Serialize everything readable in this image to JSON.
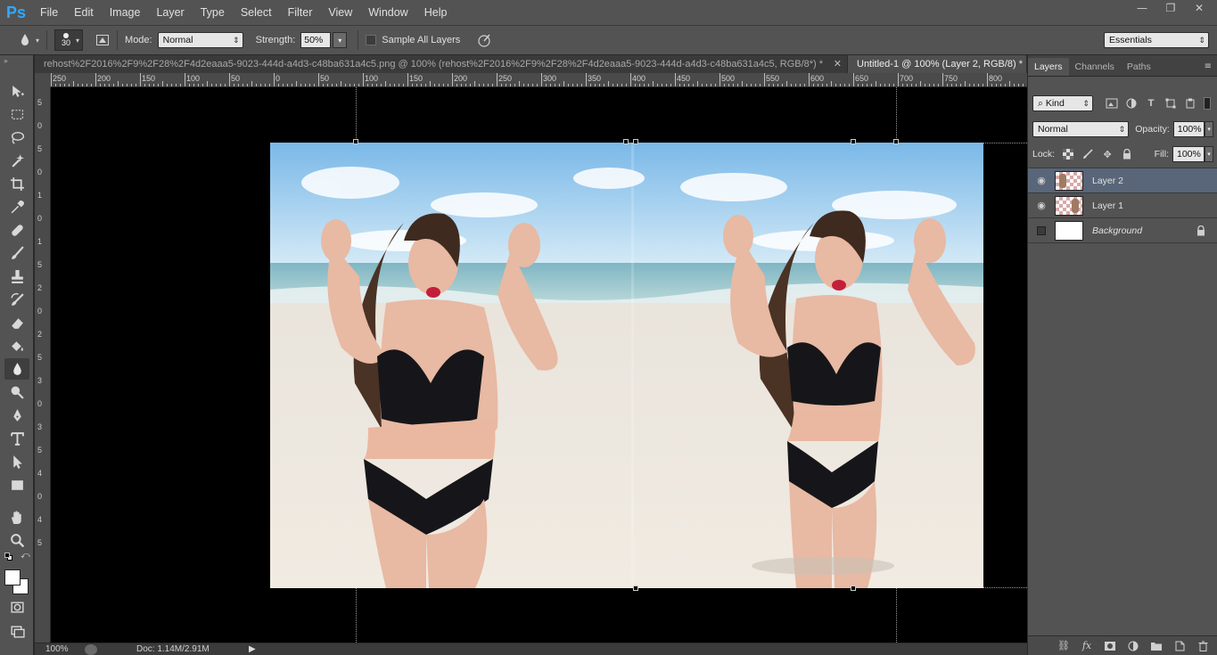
{
  "app": {
    "logo": "Ps"
  },
  "menu": [
    "File",
    "Edit",
    "Image",
    "Layer",
    "Type",
    "Select",
    "Filter",
    "View",
    "Window",
    "Help"
  ],
  "window_controls": {
    "minimize": "—",
    "restore": "❐",
    "close": "✕"
  },
  "options": {
    "brush_size": "30",
    "mode_label": "Mode:",
    "mode_value": "Normal",
    "strength_label": "Strength:",
    "strength_value": "50%",
    "sample_all_layers": "Sample All Layers",
    "workspace": "Essentials"
  },
  "tabs": [
    {
      "label": "rehost%2F2016%2F9%2F28%2F4d2eaaa5-9023-444d-a4d3-c48ba631a4c5.png @ 100% (rehost%2F2016%2F9%2F28%2F4d2eaaa5-9023-444d-a4d3-c48ba631a4c5, RGB/8*) *",
      "close": "✕"
    },
    {
      "label": "Untitled-1 @ 100% (Layer 2, RGB/8) *",
      "close": "✕"
    }
  ],
  "ruler_h": [
    "250",
    "200",
    "150",
    "100",
    "50",
    "0",
    "50",
    "100",
    "150",
    "200",
    "250",
    "300",
    "350",
    "400",
    "450",
    "500",
    "550",
    "600",
    "650",
    "700",
    "750",
    "800"
  ],
  "ruler_v": [
    "5",
    "0",
    "5",
    "0",
    "1",
    "0",
    "1",
    "5",
    "2",
    "0",
    "2",
    "5",
    "3",
    "0",
    "3",
    "5",
    "4",
    "0",
    "4",
    "5"
  ],
  "status": {
    "zoom": "100%",
    "doc": "Doc: 1.14M/2.91M"
  },
  "panel": {
    "tabs": [
      "Layers",
      "Channels",
      "Paths"
    ],
    "filter_kind": "Kind",
    "blend_mode": "Normal",
    "opacity_label": "Opacity:",
    "opacity_value": "100%",
    "lock_label": "Lock:",
    "fill_label": "Fill:",
    "fill_value": "100%",
    "layers": [
      {
        "name": "Layer 2",
        "visible": true,
        "selected": true
      },
      {
        "name": "Layer 1",
        "visible": true,
        "selected": false
      },
      {
        "name": "Background",
        "visible": false,
        "selected": false,
        "locked": true
      }
    ]
  },
  "colors": {
    "accent": "#31a8ff",
    "selection": "#596679"
  }
}
